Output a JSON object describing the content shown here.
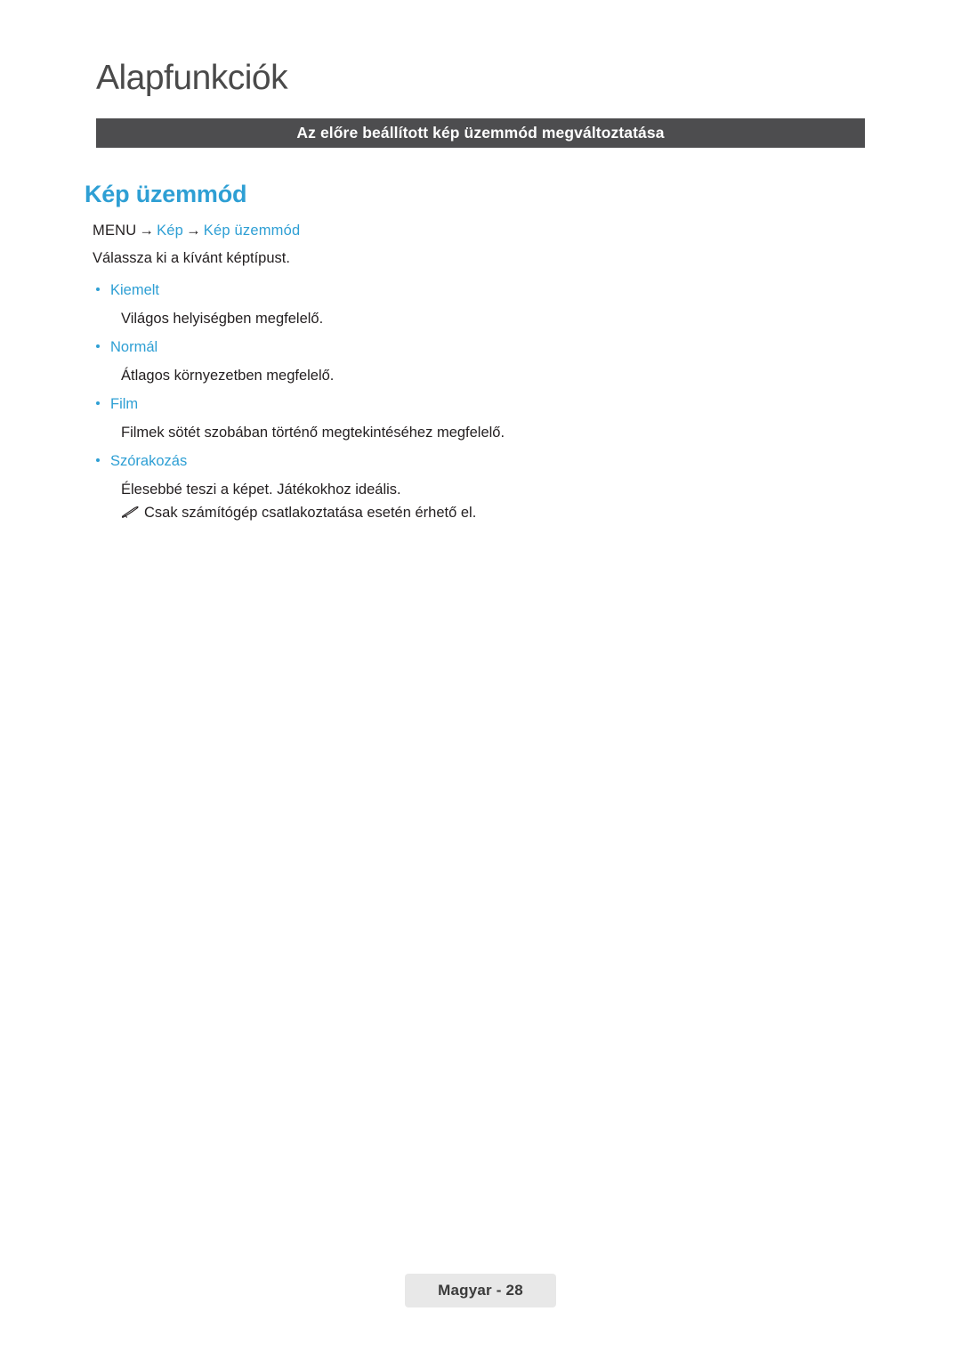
{
  "document": {
    "chapter_title": "Alapfunkciók",
    "section_banner": "Az előre beállított kép üzemmód megváltoztatása",
    "heading": "Kép üzemmód",
    "menu_path": {
      "root": "MENU",
      "level1": "Kép",
      "level2": "Kép üzemmód",
      "arrow": "→"
    },
    "intro": "Válassza ki a kívánt képtípust.",
    "options": [
      {
        "name": "Kiemelt",
        "description": "Világos helyiségben megfelelő."
      },
      {
        "name": "Normál",
        "description": "Átlagos környezetben megfelelő."
      },
      {
        "name": "Film",
        "description": "Filmek sötét szobában történő megtekintéséhez megfelelő."
      },
      {
        "name": "Szórakozás",
        "description": "Élesebbé teszi a képet. Játékokhoz ideális."
      }
    ],
    "note": "Csak számítógép csatlakoztatása esetén érhető el.",
    "note_icon": "pencil-note-icon",
    "footer": "Magyar - 28"
  },
  "colors": {
    "accent": "#2e9fd4",
    "banner_bg": "#4d4d4f",
    "text": "#231f20",
    "footer_bg": "#e8e8e8"
  }
}
